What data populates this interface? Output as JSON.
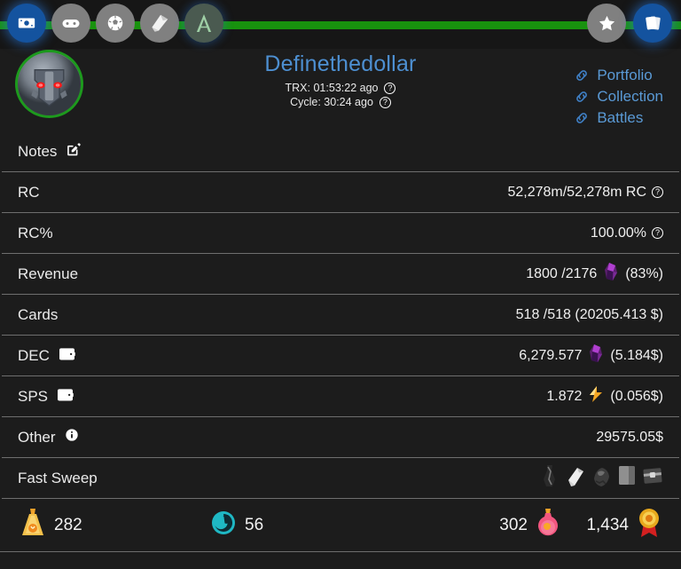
{
  "topnav": {
    "left_items": [
      {
        "name": "money-icon",
        "active": true
      },
      {
        "name": "gamepad-icon",
        "active": false
      },
      {
        "name": "soccer-ball-icon",
        "active": false
      },
      {
        "name": "scroll-icon",
        "active": false
      },
      {
        "name": "letter-a-icon",
        "active": false
      }
    ],
    "right_items": [
      {
        "name": "star-icon",
        "active": false
      },
      {
        "name": "cards-icon",
        "active": true
      }
    ],
    "progress_percent": 100,
    "progress_color": "#18920e"
  },
  "header": {
    "username": "Definethedollar",
    "trx_label": "TRX:",
    "trx_value": "01:53:22 ago",
    "cycle_label": "Cycle:",
    "cycle_value": "30:24 ago",
    "help_glyph": "?",
    "links": [
      {
        "label": "Portfolio"
      },
      {
        "label": "Collection"
      },
      {
        "label": "Battles"
      }
    ]
  },
  "rows": [
    {
      "label": "Notes",
      "value": ""
    },
    {
      "label": "RC",
      "value": "52,278m/52,278m RC"
    },
    {
      "label": "RC%",
      "value": "100.00%"
    },
    {
      "label": "Revenue",
      "value": "1800 /2176",
      "suffix": "(83%)"
    },
    {
      "label": "Cards",
      "value": "518 /518 (20205.413 $)"
    },
    {
      "label": "DEC",
      "value": "6,279.577",
      "suffix": "(5.184$)"
    },
    {
      "label": "SPS",
      "value": "1.872",
      "suffix": "(0.056$)"
    },
    {
      "label": "Other",
      "value": "29575.05$"
    },
    {
      "label": "Fast Sweep",
      "value": ""
    }
  ],
  "stats": [
    {
      "value": "282",
      "icon": "potion-bag-icon"
    },
    {
      "value": "56",
      "icon": "teal-spiral-icon"
    },
    {
      "value": "302",
      "icon": "pink-potion-icon"
    },
    {
      "value": "1,434",
      "icon": "gold-medal-icon"
    }
  ],
  "colors": {
    "accent_blue": "#4d8fd1",
    "link_blue": "#5a9ad6",
    "progress_green": "#18920e",
    "avatar_ring_green": "#1d9a1d",
    "background": "#1c1c1c"
  }
}
